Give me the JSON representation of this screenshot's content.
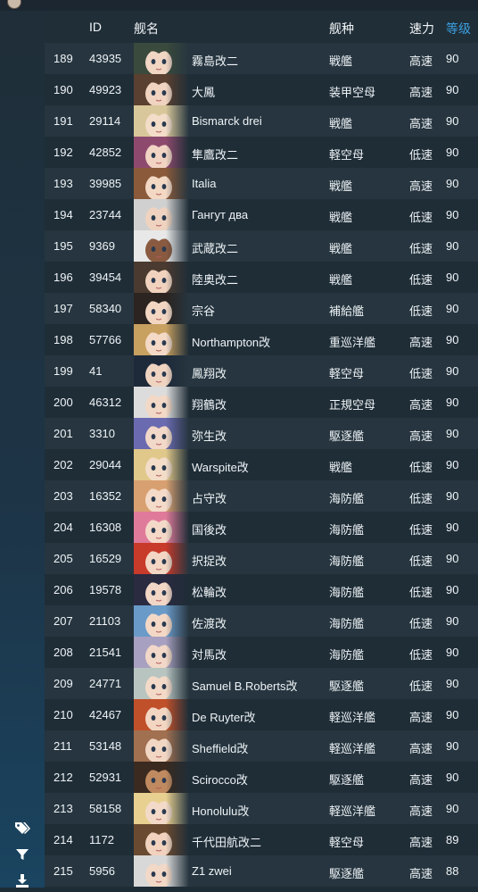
{
  "headers": {
    "no": "",
    "id": "ID",
    "name": "舰名",
    "type": "舰种",
    "speed": "速力",
    "level": "等级"
  },
  "sidebar_icons": [
    "tags-icon",
    "filter-icon",
    "download-icon"
  ],
  "rows": [
    {
      "no": "189",
      "id": "43935",
      "name": "霧島改二",
      "type": "戦艦",
      "speed": "高速",
      "level": "90",
      "hair": "#3a4a3c",
      "skin": "#f1d6c4"
    },
    {
      "no": "190",
      "id": "49923",
      "name": "大鳳",
      "type": "装甲空母",
      "speed": "高速",
      "level": "90",
      "hair": "#5a4030",
      "skin": "#f0d3c0"
    },
    {
      "no": "191",
      "id": "29114",
      "name": "Bismarck drei",
      "type": "戦艦",
      "speed": "高速",
      "level": "90",
      "hair": "#d8c79a",
      "skin": "#f3dcc8"
    },
    {
      "no": "192",
      "id": "42852",
      "name": "隼鷹改二",
      "type": "軽空母",
      "speed": "低速",
      "level": "90",
      "hair": "#8e4a6e",
      "skin": "#f2d4c4"
    },
    {
      "no": "193",
      "id": "39985",
      "name": "Italia",
      "type": "戦艦",
      "speed": "高速",
      "level": "90",
      "hair": "#8a5a3a",
      "skin": "#f3d8c4"
    },
    {
      "no": "194",
      "id": "23744",
      "name": "Гангут два",
      "type": "戦艦",
      "speed": "低速",
      "level": "90",
      "hair": "#d0d0d0",
      "skin": "#efd3c0"
    },
    {
      "no": "195",
      "id": "9369",
      "name": "武蔵改二",
      "type": "戦艦",
      "speed": "低速",
      "level": "90",
      "hair": "#e8e8e8",
      "skin": "#8a5a40"
    },
    {
      "no": "196",
      "id": "39454",
      "name": "陸奥改二",
      "type": "戦艦",
      "speed": "低速",
      "level": "90",
      "hair": "#4a3a30",
      "skin": "#f0d2be"
    },
    {
      "no": "197",
      "id": "58340",
      "name": "宗谷",
      "type": "補給艦",
      "speed": "低速",
      "level": "90",
      "hair": "#2c2420",
      "skin": "#f2d6c2"
    },
    {
      "no": "198",
      "id": "57766",
      "name": "Northampton改",
      "type": "重巡洋艦",
      "speed": "高速",
      "level": "90",
      "hair": "#c8a060",
      "skin": "#f3d9c6"
    },
    {
      "no": "199",
      "id": "41",
      "name": "鳳翔改",
      "type": "軽空母",
      "speed": "低速",
      "level": "90",
      "hair": "#1e2a3a",
      "skin": "#f0d4c2"
    },
    {
      "no": "200",
      "id": "46312",
      "name": "翔鶴改",
      "type": "正規空母",
      "speed": "高速",
      "level": "90",
      "hair": "#dcdcdc",
      "skin": "#f2d8c6"
    },
    {
      "no": "201",
      "id": "3310",
      "name": "弥生改",
      "type": "駆逐艦",
      "speed": "高速",
      "level": "90",
      "hair": "#6a6ab0",
      "skin": "#f2d8c8"
    },
    {
      "no": "202",
      "id": "29044",
      "name": "Warspite改",
      "type": "戦艦",
      "speed": "低速",
      "level": "90",
      "hair": "#e0c88a",
      "skin": "#f3dcc8"
    },
    {
      "no": "203",
      "id": "16352",
      "name": "占守改",
      "type": "海防艦",
      "speed": "低速",
      "level": "90",
      "hair": "#d8a070",
      "skin": "#f4dac8"
    },
    {
      "no": "204",
      "id": "16308",
      "name": "国後改",
      "type": "海防艦",
      "speed": "低速",
      "level": "90",
      "hair": "#e07a9a",
      "skin": "#f4d8c8"
    },
    {
      "no": "205",
      "id": "16529",
      "name": "択捉改",
      "type": "海防艦",
      "speed": "低速",
      "level": "90",
      "hair": "#c83a2a",
      "skin": "#f3d6c4"
    },
    {
      "no": "206",
      "id": "19578",
      "name": "松輪改",
      "type": "海防艦",
      "speed": "低速",
      "level": "90",
      "hair": "#2a2a40",
      "skin": "#f2d6c6"
    },
    {
      "no": "207",
      "id": "21103",
      "name": "佐渡改",
      "type": "海防艦",
      "speed": "低速",
      "level": "90",
      "hair": "#6a9ac8",
      "skin": "#f3d8c6"
    },
    {
      "no": "208",
      "id": "21541",
      "name": "対馬改",
      "type": "海防艦",
      "speed": "低速",
      "level": "90",
      "hair": "#a8a0c0",
      "skin": "#f2d8c8"
    },
    {
      "no": "209",
      "id": "24771",
      "name": "Samuel B.Roberts改",
      "type": "駆逐艦",
      "speed": "低速",
      "level": "90",
      "hair": "#b8c4c0",
      "skin": "#f3dac8"
    },
    {
      "no": "210",
      "id": "42467",
      "name": "De Ruyter改",
      "type": "軽巡洋艦",
      "speed": "高速",
      "level": "90",
      "hair": "#c0502a",
      "skin": "#f2d6c2"
    },
    {
      "no": "211",
      "id": "53148",
      "name": "Sheffield改",
      "type": "軽巡洋艦",
      "speed": "高速",
      "level": "90",
      "hair": "#a07050",
      "skin": "#f2d6c4"
    },
    {
      "no": "212",
      "id": "52931",
      "name": "Scirocco改",
      "type": "駆逐艦",
      "speed": "高速",
      "level": "90",
      "hair": "#3a2a20",
      "skin": "#c08a60"
    },
    {
      "no": "213",
      "id": "58158",
      "name": "Honolulu改",
      "type": "軽巡洋艦",
      "speed": "高速",
      "level": "90",
      "hair": "#e8d090",
      "skin": "#f3dac8"
    },
    {
      "no": "214",
      "id": "1172",
      "name": "千代田航改二",
      "type": "軽空母",
      "speed": "高速",
      "level": "89",
      "hair": "#6a4a30",
      "skin": "#f0d2be"
    },
    {
      "no": "215",
      "id": "5956",
      "name": "Z1 zwei",
      "type": "駆逐艦",
      "speed": "高速",
      "level": "88",
      "hair": "#d8d8d8",
      "skin": "#f2d8c6"
    }
  ]
}
